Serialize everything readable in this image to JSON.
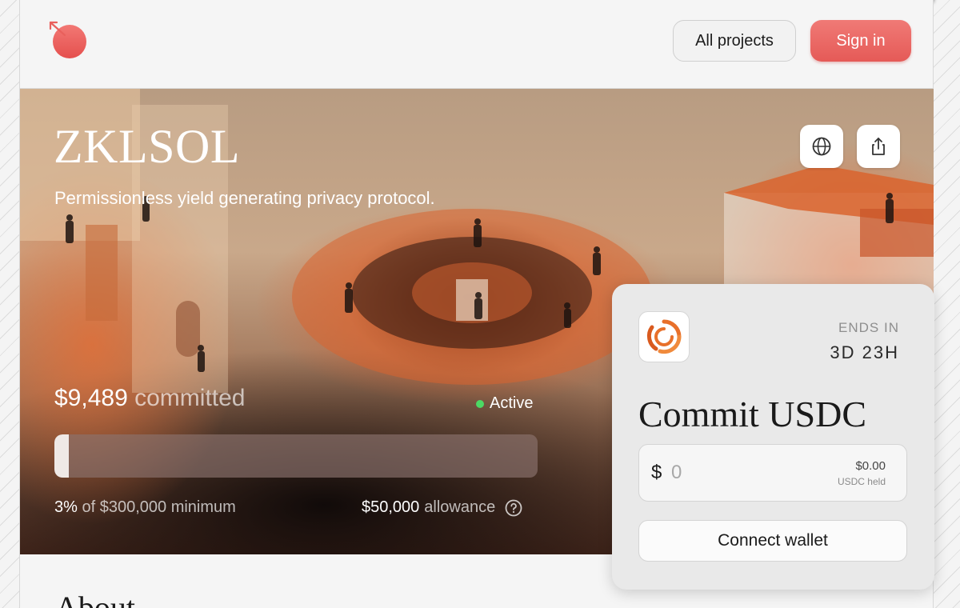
{
  "header": {
    "all_projects_label": "All projects",
    "sign_in_label": "Sign in"
  },
  "hero": {
    "title": "ZKLSOL",
    "subtitle": "Permissionless yield generating privacy protocol.",
    "committed_amount": "$9,489",
    "committed_label": "committed",
    "status_label": "Active",
    "progress_percent": 3,
    "progress_percent_label": "3%",
    "progress_of": "of",
    "minimum_amount": "$300,000",
    "minimum_label": "minimum",
    "allowance_amount": "$50,000",
    "allowance_label": "allowance"
  },
  "commit_card": {
    "ends_in_label": "ENDS IN",
    "ends_in_value": "3D 23H",
    "title": "Commit USDC",
    "currency_symbol": "$",
    "amount_placeholder": "0",
    "held_value": "$0.00",
    "held_label": "USDC held",
    "connect_label": "Connect wallet"
  },
  "about": {
    "heading": "About"
  },
  "colors": {
    "accent": "#e9605c",
    "status_active": "#4cd964",
    "token_orange": "#e8702a"
  },
  "icons": {
    "logo": "arrow-circle-logo-icon",
    "website": "globe-icon",
    "share": "share-icon",
    "help": "question-circle-icon"
  }
}
